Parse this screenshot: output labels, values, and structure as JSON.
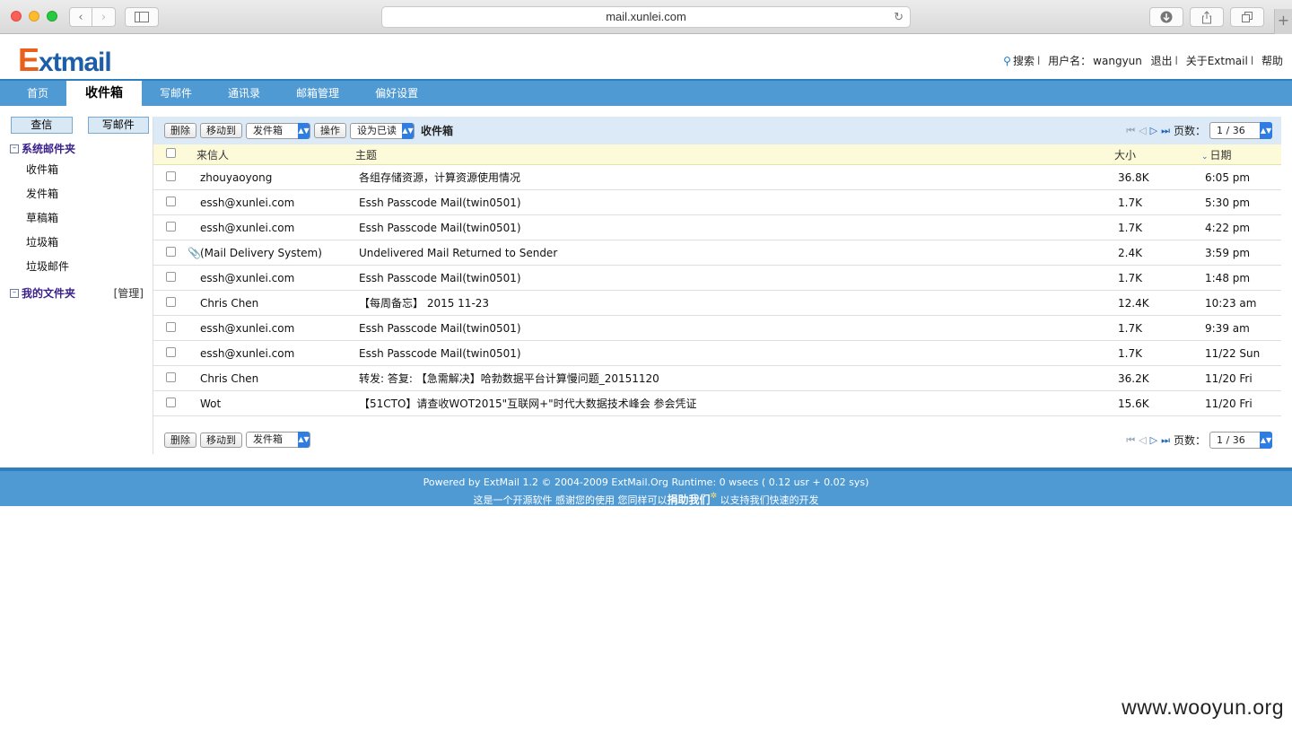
{
  "browser": {
    "url": "mail.xunlei.com"
  },
  "header": {
    "logo_first": "E",
    "logo_rest": "xtmail",
    "search": "搜索",
    "user_label": "用户名：",
    "username": "wangyun",
    "logout": "退出",
    "about": "关于Extmail",
    "help": "帮助",
    "sep": "l"
  },
  "tabs": [
    {
      "label": "首页"
    },
    {
      "label": "收件箱"
    },
    {
      "label": "写邮件"
    },
    {
      "label": "通讯录"
    },
    {
      "label": "邮箱管理"
    },
    {
      "label": "偏好设置"
    }
  ],
  "sidebar": {
    "check_btn": "查信",
    "compose_btn": "写邮件",
    "system_folders": "系统邮件夹",
    "folders": [
      {
        "label": "收件箱"
      },
      {
        "label": "发件箱"
      },
      {
        "label": "草稿箱"
      },
      {
        "label": "垃圾箱"
      },
      {
        "label": "垃圾邮件"
      }
    ],
    "my_folders": "我的文件夹",
    "manage": "[管理]"
  },
  "toolbar": {
    "delete": "删除",
    "move_to": "移动到",
    "move_target": "发件箱",
    "operate": "操作",
    "mark_as": "设为已读",
    "folder_title": "收件箱",
    "page_label": "页数：",
    "page_value": "1 / 36"
  },
  "columns": {
    "from": "来信人",
    "subject": "主题",
    "size": "大小",
    "date": "日期"
  },
  "messages": [
    {
      "from": "zhouyaoyong",
      "subject": "各组存储资源，计算资源使用情况",
      "size": "36.8K",
      "date": "6:05 pm",
      "attach": ""
    },
    {
      "from": "essh@xunlei.com",
      "subject": "Essh Passcode Mail(twin0501)",
      "size": "1.7K",
      "date": "5:30 pm",
      "attach": ""
    },
    {
      "from": "essh@xunlei.com",
      "subject": "Essh Passcode Mail(twin0501)",
      "size": "1.7K",
      "date": "4:22 pm",
      "attach": ""
    },
    {
      "from": "(Mail Delivery System)",
      "subject": "Undelivered Mail Returned to Sender",
      "size": "2.4K",
      "date": "3:59 pm",
      "attach": "📎"
    },
    {
      "from": "essh@xunlei.com",
      "subject": "Essh Passcode Mail(twin0501)",
      "size": "1.7K",
      "date": "1:48 pm",
      "attach": ""
    },
    {
      "from": "Chris Chen",
      "subject": "【每周备忘】 2015 11-23",
      "size": "12.4K",
      "date": "10:23 am",
      "attach": ""
    },
    {
      "from": "essh@xunlei.com",
      "subject": "Essh Passcode Mail(twin0501)",
      "size": "1.7K",
      "date": "9:39 am",
      "attach": ""
    },
    {
      "from": "essh@xunlei.com",
      "subject": "Essh Passcode Mail(twin0501)",
      "size": "1.7K",
      "date": "11/22 Sun",
      "attach": ""
    },
    {
      "from": "Chris Chen",
      "subject": "转发: 答复: 【急需解决】哈勃数据平台计算慢问题_20151120",
      "size": "36.2K",
      "date": "11/20 Fri",
      "attach": ""
    },
    {
      "from": "Wot",
      "subject": "【51CTO】请查收WOT2015\"互联网+\"时代大数据技术峰会 参会凭证",
      "size": "15.6K",
      "date": "11/20 Fri",
      "attach": ""
    }
  ],
  "footer": {
    "line1": "Powered by ExtMail 1.2 © 2004-2009 ExtMail.Org Runtime: 0 wsecs ( 0.12 usr + 0.02 sys)",
    "line2_pre": "这是一个开源软件 感谢您的使用 您同样可以",
    "line2_bold": "捐助我们",
    "line2_post": " 以支持我们快速的开发"
  },
  "watermark": "www.wooyun.org"
}
